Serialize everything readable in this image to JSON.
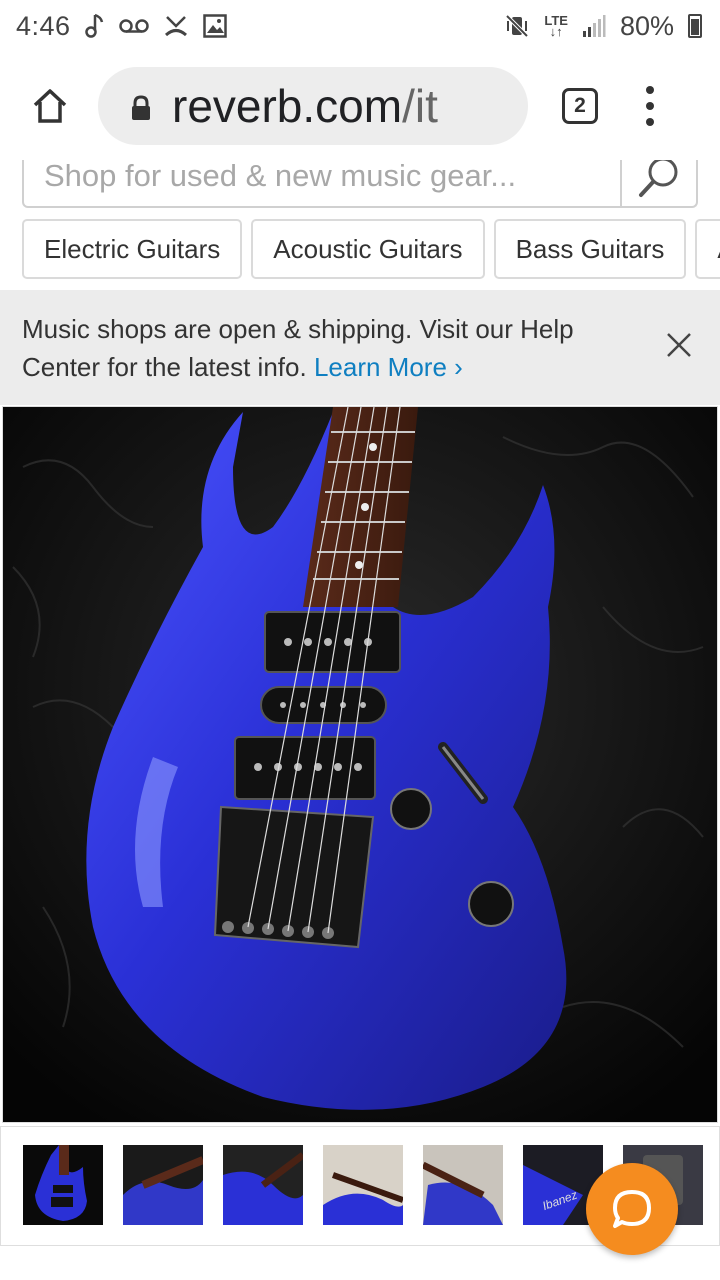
{
  "status_bar": {
    "time": "4:46",
    "network": "LTE",
    "battery_percent": "80%"
  },
  "browser": {
    "url_main": "reverb.com",
    "url_tail": "/it",
    "tab_count": "2"
  },
  "search": {
    "placeholder": "Shop for used & new music gear..."
  },
  "categories": [
    {
      "label": "Electric Guitars"
    },
    {
      "label": "Acoustic Guitars"
    },
    {
      "label": "Bass Guitars"
    },
    {
      "label": "A"
    }
  ],
  "notice": {
    "message": "Music shops are open & shipping. Visit our Help Center for the latest info.",
    "link_label": "Learn More ›"
  },
  "gallery": {
    "main_image": "blue-electric-guitar-photo",
    "thumbnail_count": 7,
    "selected_index": 0
  },
  "colors": {
    "accent_link": "#0f7fc1",
    "chat_button": "#f58c1f",
    "guitar_blue": "#2a2fd0"
  },
  "icons": {
    "home": "home-icon",
    "lock": "lock-icon",
    "search": "search-icon",
    "close": "close-icon",
    "chat": "chat-icon",
    "menu": "more-vert-icon"
  }
}
